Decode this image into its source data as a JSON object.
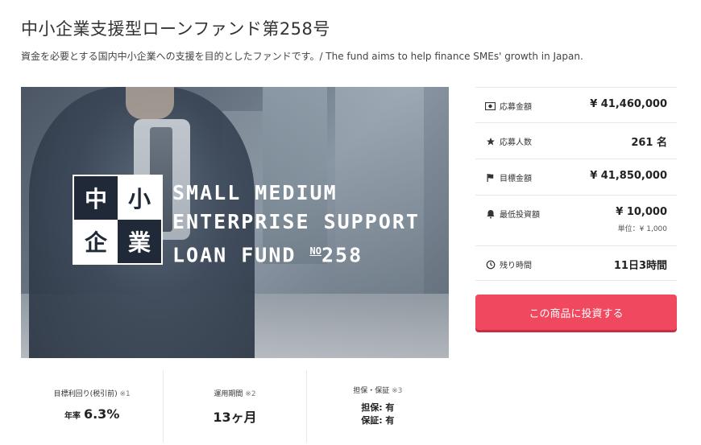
{
  "title": "中小企業支援型ローンファンド第258号",
  "subtitle": "資金を必要とする国内中小企業への支援を目的としたファンドです。/ The fund aims to help finance SMEs' growth in Japan.",
  "hero": {
    "logo_chars": [
      "中",
      "小",
      "企",
      "業"
    ],
    "lines": [
      "SMALL MEDIUM",
      "ENTERPRISE SUPPORT",
      "LOAN FUND"
    ],
    "no_mark": "NO",
    "number": "258"
  },
  "info": {
    "applied_amount": {
      "icon": "money-icon",
      "label": "応募金額",
      "value": "¥ 41,460,000"
    },
    "applicants": {
      "icon": "star-icon",
      "label": "応募人数",
      "value": "261 名"
    },
    "target_amount": {
      "icon": "flag-icon",
      "label": "目標金額",
      "value": "¥ 41,850,000"
    },
    "min_investment": {
      "icon": "bell-icon",
      "label": "最低投資額",
      "value": "¥ 10,000",
      "sub": "単位：¥ 1,000"
    },
    "remaining_time": {
      "icon": "clock-icon",
      "label": "残り時間",
      "value": "11日3時間"
    }
  },
  "invest_button": "この商品に投資する",
  "stats": {
    "yield": {
      "label": "目標利回り(税引前)",
      "note": "※1",
      "prefix": "年率",
      "value": "6.3%"
    },
    "period": {
      "label": "運用期間",
      "note": "※2",
      "value": "13ヶ月"
    },
    "collateral": {
      "label": "担保・保証",
      "note": "※3",
      "line1": "担保: 有",
      "line2": "保証: 有"
    }
  },
  "colors": {
    "accent": "#f0485e",
    "logo_dark": "#1f2937"
  }
}
